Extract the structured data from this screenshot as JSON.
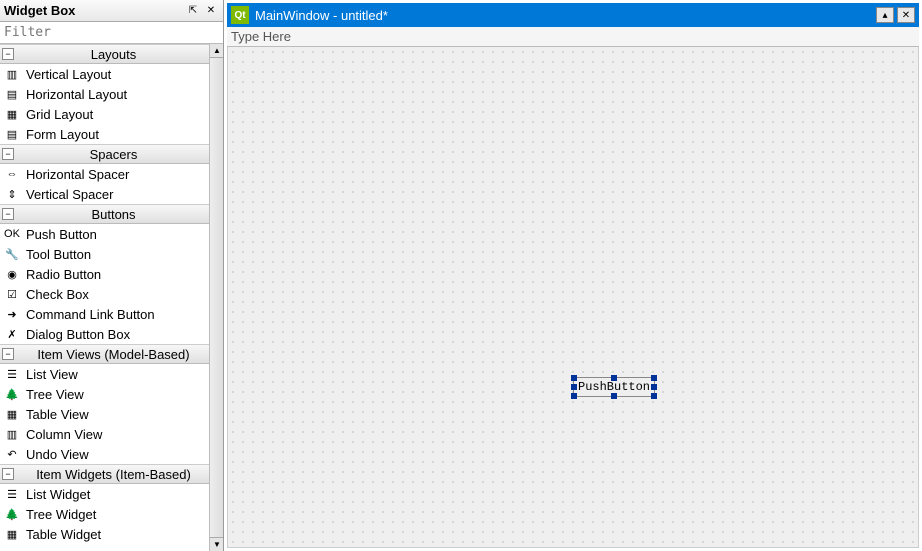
{
  "widget_box": {
    "title": "Widget Box",
    "filter_placeholder": "Filter",
    "categories": [
      {
        "name": "Layouts",
        "items": [
          {
            "label": "Vertical Layout",
            "icon": "v-layout-icon",
            "glyph": "▥"
          },
          {
            "label": "Horizontal Layout",
            "icon": "h-layout-icon",
            "glyph": "▤"
          },
          {
            "label": "Grid Layout",
            "icon": "grid-layout-icon",
            "glyph": "▦"
          },
          {
            "label": "Form Layout",
            "icon": "form-layout-icon",
            "glyph": "▤"
          }
        ]
      },
      {
        "name": "Spacers",
        "items": [
          {
            "label": "Horizontal Spacer",
            "icon": "h-spacer-icon",
            "glyph": "⇔"
          },
          {
            "label": "Vertical Spacer",
            "icon": "v-spacer-icon",
            "glyph": "⇕"
          }
        ]
      },
      {
        "name": "Buttons",
        "items": [
          {
            "label": "Push Button",
            "icon": "push-button-icon",
            "glyph": "OK"
          },
          {
            "label": "Tool Button",
            "icon": "tool-button-icon",
            "glyph": "🔧"
          },
          {
            "label": "Radio Button",
            "icon": "radio-button-icon",
            "glyph": "◉"
          },
          {
            "label": "Check Box",
            "icon": "checkbox-icon",
            "glyph": "☑"
          },
          {
            "label": "Command Link Button",
            "icon": "command-link-icon",
            "glyph": "➜"
          },
          {
            "label": "Dialog Button Box",
            "icon": "dialog-buttonbox-icon",
            "glyph": "✗"
          }
        ]
      },
      {
        "name": "Item Views (Model-Based)",
        "items": [
          {
            "label": "List View",
            "icon": "list-view-icon",
            "glyph": "☰"
          },
          {
            "label": "Tree View",
            "icon": "tree-view-icon",
            "glyph": "🌲"
          },
          {
            "label": "Table View",
            "icon": "table-view-icon",
            "glyph": "▦"
          },
          {
            "label": "Column View",
            "icon": "column-view-icon",
            "glyph": "▥"
          },
          {
            "label": "Undo View",
            "icon": "undo-view-icon",
            "glyph": "↶"
          }
        ]
      },
      {
        "name": "Item Widgets (Item-Based)",
        "items": [
          {
            "label": "List Widget",
            "icon": "list-widget-icon",
            "glyph": "☰"
          },
          {
            "label": "Tree Widget",
            "icon": "tree-widget-icon",
            "glyph": "🌲"
          },
          {
            "label": "Table Widget",
            "icon": "table-widget-icon",
            "glyph": "▦"
          }
        ]
      }
    ]
  },
  "designer": {
    "window_title": "MainWindow - untitled*",
    "menu_placeholder": "Type Here",
    "placed_widget_text": "PushButton"
  }
}
